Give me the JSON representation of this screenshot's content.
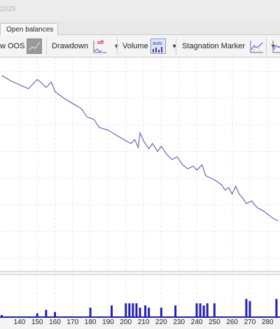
{
  "window": {
    "title_fragment": "2025"
  },
  "tabs": [
    {
      "label": "Open balances"
    }
  ],
  "toolbar": {
    "show_oos_label": "w OOS",
    "drawdown_label": "Drawdown",
    "drawdown_icon_text": "off",
    "volume_label": "Volume",
    "volume_icon_text": "auto",
    "stagnation_label": "Stagnation Marker"
  },
  "colors": {
    "equity_line": "#6464c8",
    "volume_bars": "#2020b8",
    "grid": "#e6e6e6"
  },
  "chart_data": {
    "type": "line",
    "series": [
      {
        "values": [
          [
            130,
            297
          ],
          [
            135,
            293
          ],
          [
            140,
            290
          ],
          [
            145,
            287
          ],
          [
            150,
            294
          ],
          [
            152,
            292
          ],
          [
            155,
            288
          ],
          [
            158,
            292
          ],
          [
            160,
            285
          ],
          [
            165,
            280
          ],
          [
            170,
            276
          ],
          [
            175,
            272
          ],
          [
            178,
            266
          ],
          [
            182,
            264
          ],
          [
            185,
            258
          ],
          [
            190,
            256
          ],
          [
            195,
            252
          ],
          [
            200,
            248
          ],
          [
            203,
            246
          ],
          [
            205,
            249
          ],
          [
            207,
            243
          ],
          [
            208,
            254
          ],
          [
            210,
            248
          ],
          [
            213,
            242
          ],
          [
            215,
            246
          ],
          [
            218,
            240
          ],
          [
            220,
            244
          ],
          [
            223,
            238
          ],
          [
            226,
            234
          ],
          [
            229,
            236
          ],
          [
            232,
            230
          ],
          [
            235,
            227
          ],
          [
            238,
            229
          ],
          [
            240,
            226
          ],
          [
            243,
            230
          ],
          [
            245,
            222
          ],
          [
            248,
            220
          ],
          [
            251,
            218
          ],
          [
            254,
            215
          ],
          [
            256,
            211
          ],
          [
            258,
            213
          ],
          [
            260,
            208
          ],
          [
            262,
            214
          ],
          [
            264,
            208
          ],
          [
            266,
            205
          ],
          [
            268,
            201
          ],
          [
            271,
            203
          ],
          [
            274,
            198
          ],
          [
            277,
            196
          ],
          [
            280,
            193
          ],
          [
            283,
            190
          ],
          [
            286,
            188
          ]
        ]
      }
    ],
    "volume": [
      [
        130,
        0.08
      ],
      [
        150,
        0.12
      ],
      [
        155,
        0.2
      ],
      [
        160,
        0.15
      ],
      [
        180,
        0.25
      ],
      [
        192,
        0.3
      ],
      [
        200,
        0.35
      ],
      [
        202,
        0.35
      ],
      [
        204,
        0.35
      ],
      [
        206,
        0.35
      ],
      [
        208,
        0.25
      ],
      [
        211,
        0.3
      ],
      [
        213,
        0.25
      ],
      [
        220,
        0.25
      ],
      [
        228,
        0.3
      ],
      [
        240,
        0.35
      ],
      [
        242,
        0.35
      ],
      [
        244,
        0.3
      ],
      [
        246,
        0.35
      ],
      [
        250,
        0.35
      ],
      [
        268,
        0.45
      ],
      [
        270,
        0.4
      ],
      [
        285,
        0.45
      ]
    ],
    "x_ticks": [
      "140",
      "150",
      "160",
      "170",
      "180",
      "190",
      "200",
      "210",
      "220",
      "230",
      "240",
      "250",
      "260",
      "270",
      "280"
    ],
    "xlim": [
      129,
      287
    ],
    "ylim": [
      150,
      310
    ],
    "grid": true
  }
}
